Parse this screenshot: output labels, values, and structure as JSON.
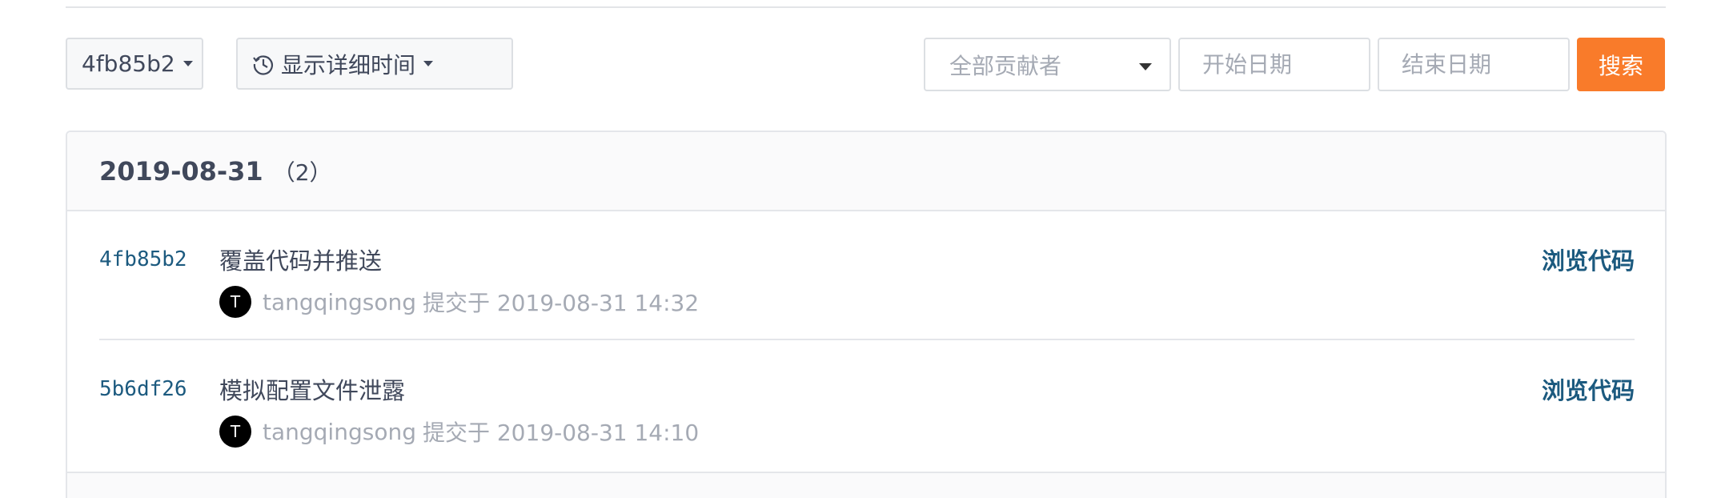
{
  "toolbar": {
    "branch_label": "4fb85b2",
    "time_label": "显示详细时间",
    "contributor_placeholder": "全部贡献者",
    "start_date_placeholder": "开始日期",
    "end_date_placeholder": "结束日期",
    "search_label": "搜索",
    "accent_color": "#f97b2a"
  },
  "group": {
    "date": "2019-08-31",
    "count": "（2）"
  },
  "commits": [
    {
      "sha": "4fb85b2",
      "message": "覆盖代码并推送",
      "browse_label": "浏览代码",
      "avatar_letter": "T",
      "author": "tangqingsong",
      "meta_text": "提交于 2019-08-31 14:32"
    },
    {
      "sha": "5b6df26",
      "message": "模拟配置文件泄露",
      "browse_label": "浏览代码",
      "avatar_letter": "T",
      "author": "tangqingsong",
      "meta_text": "提交于 2019-08-31 14:10"
    }
  ],
  "icons": {
    "time": "clock-history-icon",
    "dropdown": "caret-down-icon"
  }
}
